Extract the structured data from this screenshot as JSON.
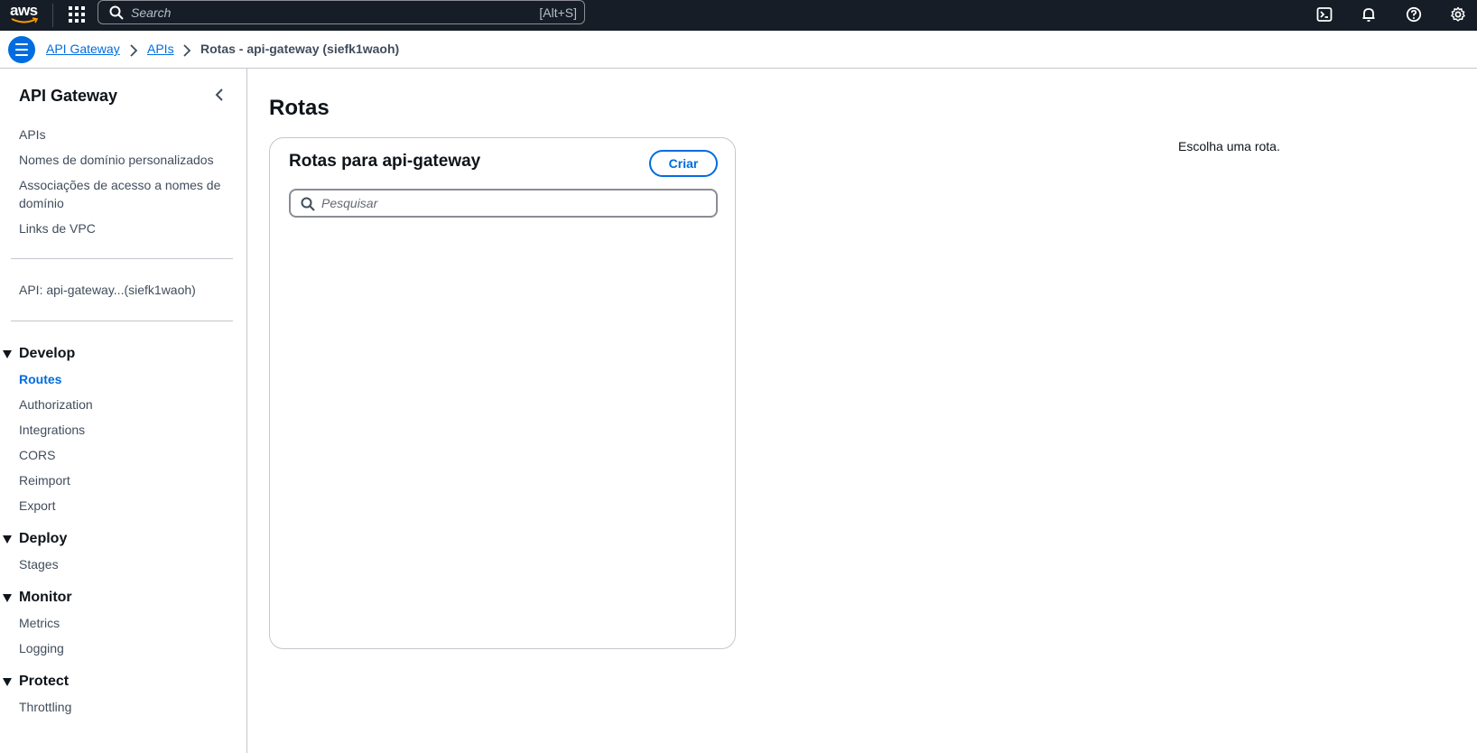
{
  "topnav": {
    "logo_text": "aws",
    "search_placeholder": "Search",
    "search_shortcut": "[Alt+S]",
    "icons": [
      "cloudshell-icon",
      "bell-icon",
      "help-icon",
      "gear-icon"
    ]
  },
  "breadcrumb": {
    "items": [
      "API Gateway",
      "APIs"
    ],
    "current": "Rotas - api-gateway (siefk1waoh)"
  },
  "sidebar": {
    "title": "API Gateway",
    "top_links": [
      "APIs",
      "Nomes de domínio personalizados",
      "Associações de acesso a nomes de domínio",
      "Links de VPC"
    ],
    "api_link": "API: api-gateway...(siefk1waoh)",
    "sections": [
      {
        "label": "Develop",
        "items": [
          "Routes",
          "Authorization",
          "Integrations",
          "CORS",
          "Reimport",
          "Export"
        ]
      },
      {
        "label": "Deploy",
        "items": [
          "Stages"
        ]
      },
      {
        "label": "Monitor",
        "items": [
          "Metrics",
          "Logging"
        ]
      },
      {
        "label": "Protect",
        "items": [
          "Throttling"
        ]
      }
    ],
    "active_item": "Routes"
  },
  "main": {
    "page_title": "Rotas",
    "panel_title": "Rotas para api-gateway",
    "create_label": "Criar",
    "search_placeholder": "Pesquisar",
    "search_value": "",
    "empty_hint": "Escolha uma rota."
  },
  "colors": {
    "topnav_bg": "#161d26",
    "accent": "#006ce0",
    "border": "#c6c6cd",
    "text": "#0f141a"
  }
}
